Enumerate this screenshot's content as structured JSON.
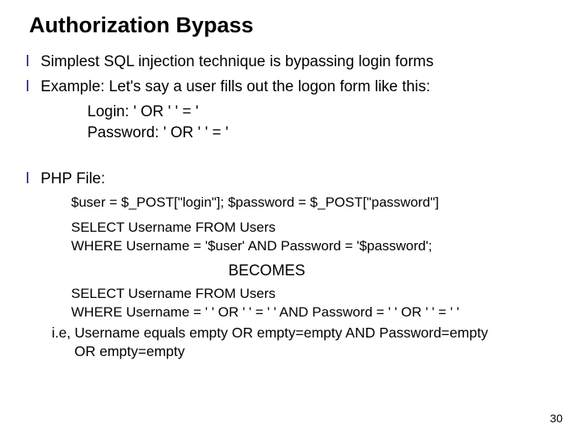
{
  "title": "Authorization Bypass",
  "bullets": {
    "b1": "Simplest SQL injection technique is bypassing login forms",
    "b2": "Example: Let's say a user fills out the logon form like this:",
    "b3": "PHP File:"
  },
  "login_block": {
    "line1": "Login:   ' OR ' ' = '",
    "line2": "Password: ' OR ' ' = '"
  },
  "php": {
    "assign": "$user = $_POST[\"login\"];   $password = $_POST[\"password\"]",
    "sql1_l1": "SELECT Username FROM Users",
    "sql1_l2": "WHERE Username = '$user' AND Password = '$password';",
    "becomes": "BECOMES",
    "sql2_l1": "SELECT Username FROM Users",
    "sql2_l2": "WHERE Username = ' ' OR ' ' = ' ' AND Password = ' ' OR ' ' = ' '",
    "ie_l1": "i.e, Username equals empty OR empty=empty AND Password=empty",
    "ie_l2": "OR empty=empty"
  },
  "page_number": "30"
}
